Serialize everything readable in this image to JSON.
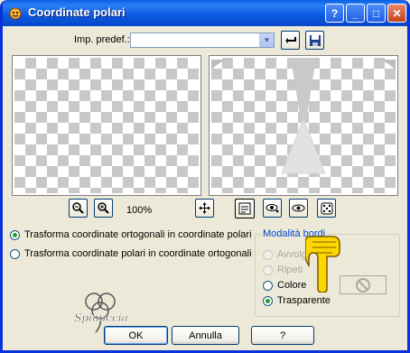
{
  "window": {
    "title": "Coordinate polari"
  },
  "titlebar_buttons": {
    "help": "?",
    "minimize": "_",
    "maximize": "□",
    "close": "✕"
  },
  "preset": {
    "label": "Imp. predef.:",
    "value": ""
  },
  "zoom": {
    "level": "100%"
  },
  "transform": {
    "options": [
      "Trasforma coordinate ortogonali in coordinate polari",
      "Trasforma coordinate polari in coordinate ortogonali"
    ],
    "selected_index": 0
  },
  "edge_mode": {
    "title": "Modalità bordi",
    "options": [
      "Avvolgi",
      "Ripeti",
      "Colore",
      "Trasparente"
    ],
    "disabled": [
      true,
      true,
      false,
      false
    ],
    "selected_index": 3
  },
  "watermark": {
    "text": "Spinuccia"
  },
  "buttons": {
    "ok": "OK",
    "cancel": "Annulla",
    "help": "?"
  },
  "colors": {
    "title_blue": "#0a5fe6",
    "dialog_bg": "#ece9d8",
    "radio_green": "#21a121",
    "hand_yellow": "#ffd700"
  },
  "icons": [
    "app-icon",
    "reset-icon",
    "save-icon",
    "zoom-out-icon",
    "zoom-in-icon",
    "move-icon",
    "proof-icon",
    "eye-dropdown-icon",
    "eye-icon",
    "random-dice-icon",
    "no-color-icon",
    "pointing-hand-icon"
  ]
}
